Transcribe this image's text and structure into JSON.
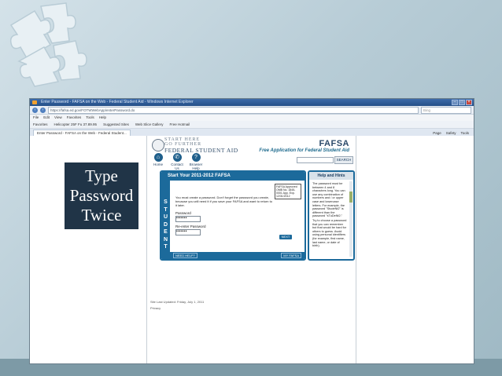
{
  "slide": {
    "label_lines": [
      "Type",
      "Password",
      "Twice"
    ]
  },
  "browser": {
    "title": "Enter Password - FAFSA on the Web - Federal Student Aid - Windows Internet Explorer",
    "url": "https://fafsa.ed.gov/FOTWWebApp/enterPassword.do",
    "search_placeholder": "Bing",
    "menu": [
      "File",
      "Edit",
      "View",
      "Favorites",
      "Tools",
      "Help"
    ],
    "favorites": [
      "Favorites",
      "Helicopter 25F Fu 37.89.95",
      "Suggested Sites",
      "Web Slice Gallery",
      "Free Hotmail"
    ],
    "tab_label": "Enter Password - FAFSA on the Web - Federal Student...",
    "tools": [
      "Page",
      "Safety",
      "Tools"
    ]
  },
  "site": {
    "logo_line1": "START HERE",
    "logo_line2": "GO FURTHER",
    "logo_line3": "FEDERAL STUDENT AID",
    "brand": "FAFSA",
    "brand_sub": "Free Application for Federal Student Aid",
    "nav": [
      {
        "label": "Home"
      },
      {
        "label": "Contact Us"
      },
      {
        "label": "Browser Help"
      }
    ],
    "search_button": "SEARCH"
  },
  "form": {
    "heading": "Start Your 2011-2012 FAFSA",
    "side_label": [
      "S",
      "T",
      "U",
      "D",
      "E",
      "N",
      "T"
    ],
    "omb": "FAFSA Approved OMB No. 1845-0001 App. Exp. 12/31/2012",
    "instructions": "You must create a password. Don't forget the password you create, because you will need it if you save your FAFSA and want to return to it later.",
    "password_label": "Password",
    "password_value": "•••••••",
    "reenter_label": "Re-enter Password",
    "reenter_value": "•••••••",
    "next_button": "NEXT",
    "need_help": "NEED HELP?",
    "my_fafsa": "MY FAFSA"
  },
  "help": {
    "heading": "Help and Hints",
    "text": "The password must be between 4 and 8 characters long. You can use any combination of numbers and / or upper case and lowercase letters. For example, the password \"StudeNt2\" is different than the password \"sTuDeNt2.\"",
    "text2": "Try to choose a password that you can remember but that would be hard for others to guess. Avoid using personal identifiers (for example, first name, last name, or date of birth)."
  },
  "footer": {
    "last_updated": "Site Last Updated: Friday, July 1, 2011",
    "privacy": "Privacy"
  }
}
